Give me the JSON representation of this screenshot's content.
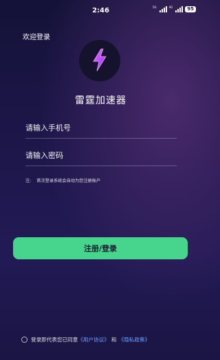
{
  "status_bar": {
    "time": "2:46",
    "signal1_label": "5G",
    "signal2_label": "4G",
    "battery": "95"
  },
  "header": {
    "welcome": "欢迎登录"
  },
  "logo": {
    "icon": "lightning-bolt-icon",
    "accent": "#c040ff"
  },
  "app": {
    "name": "雷霆加速器"
  },
  "form": {
    "phone_placeholder": "请输入手机号",
    "password_placeholder": "请输入密码",
    "note_prefix": "注:",
    "note_text": "首次登录系统会自动为您注册账户",
    "submit_label": "注册/登录"
  },
  "agreement": {
    "text": "登录即代表您已同意",
    "user_agreement": "《用户协议》",
    "and": "和",
    "privacy_policy": "《隐私政策》",
    "link_color": "#6fa0ff"
  },
  "colors": {
    "primary_button": "#47d48c"
  }
}
